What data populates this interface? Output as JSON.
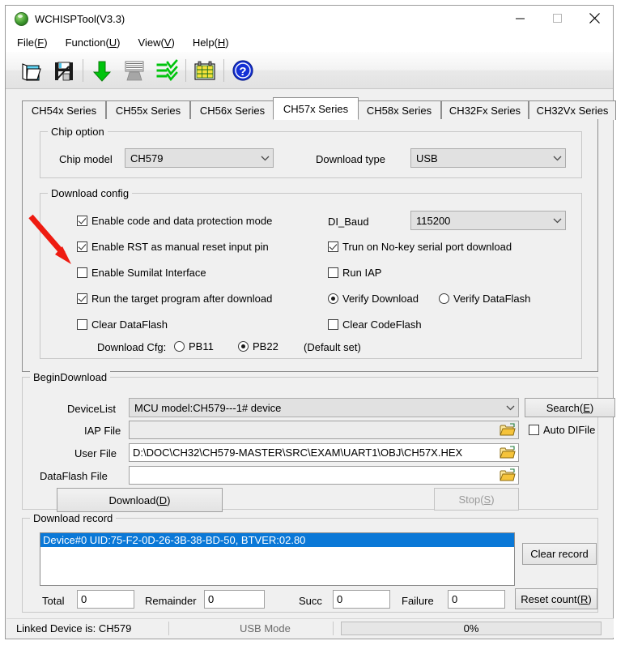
{
  "window": {
    "title": "WCHISPTool(V3.3)",
    "icon": "app-globe-icon",
    "minimize": "minimize-icon",
    "maximize": "maximize-icon",
    "close": "close-icon"
  },
  "menu": [
    {
      "label": "File(F)",
      "text": "File(",
      "accel": "F",
      "tail": ")"
    },
    {
      "label": "Function(U)",
      "text": "Function(",
      "accel": "U",
      "tail": ")"
    },
    {
      "label": "View(V)",
      "text": "View(",
      "accel": "V",
      "tail": ")"
    },
    {
      "label": "Help(H)",
      "text": "Help(",
      "accel": "H",
      "tail": ")"
    }
  ],
  "toolbar": {
    "items": [
      {
        "name": "open-file-icon"
      },
      {
        "name": "save-file-icon"
      },
      {
        "name": "download-arrow-icon"
      },
      {
        "name": "erase-chip-icon"
      },
      {
        "name": "verify-list-icon"
      },
      {
        "name": "config-table-icon"
      },
      {
        "name": "help-question-icon"
      }
    ]
  },
  "tabs": [
    {
      "label": "CH54x Series",
      "active": false
    },
    {
      "label": "CH55x Series",
      "active": false
    },
    {
      "label": "CH56x Series",
      "active": false
    },
    {
      "label": "CH57x Series",
      "active": true
    },
    {
      "label": "CH58x Series",
      "active": false
    },
    {
      "label": "CH32Fx Series",
      "active": false
    },
    {
      "label": "CH32Vx Series",
      "active": false
    }
  ],
  "chip_option": {
    "group_label": "Chip option",
    "chip_model_label": "Chip model",
    "chip_model_value": "CH579",
    "download_type_label": "Download type",
    "download_type_value": "USB"
  },
  "download_config": {
    "group_label": "Download config",
    "checkboxes_left": [
      {
        "label": "Enable code and data protection mode",
        "checked": true
      },
      {
        "label": "Enable RST as manual reset input pin",
        "checked": true
      },
      {
        "label": "Enable Sumilat Interface",
        "checked": false
      },
      {
        "label": "Run the target program after download",
        "checked": true
      },
      {
        "label": "Clear DataFlash",
        "checked": false
      }
    ],
    "di_baud_label": "DI_Baud",
    "di_baud_value": "115200",
    "checkbox_nokey": {
      "label": "Trun on No-key serial port download",
      "checked": true
    },
    "checkbox_runiap": {
      "label": "Run IAP",
      "checked": false
    },
    "radio_verify_download": {
      "label": "Verify Download",
      "selected": true
    },
    "radio_verify_dataflash": {
      "label": "Verify DataFlash",
      "selected": false
    },
    "checkbox_clear_codeflash": {
      "label": "Clear CodeFlash",
      "checked": false
    },
    "download_cfg_label": "Download Cfg:",
    "radio_pb11": {
      "label": "PB11",
      "selected": false
    },
    "radio_pb22": {
      "label": "PB22",
      "selected": true
    },
    "default_set_note": "(Default set)"
  },
  "begin_download": {
    "group_label": "BeginDownload",
    "device_list_label": "DeviceList",
    "device_list_value": "MCU model:CH579---1# device",
    "search_button": {
      "text": "Search(",
      "accel": "E",
      "tail": ")"
    },
    "iap_file_label": "IAP File",
    "iap_file_value": "",
    "auto_difile": {
      "label": "Auto DIFile",
      "checked": false
    },
    "user_file_label": "User File",
    "user_file_value": "D:\\DOC\\CH32\\CH579-MASTER\\SRC\\EXAM\\UART1\\OBJ\\CH57X.HEX",
    "dataflash_file_label": "DataFlash File",
    "dataflash_file_value": "",
    "download_button": {
      "text": "Download(",
      "accel": "D",
      "tail": ")"
    },
    "stop_button": {
      "text": "Stop(",
      "accel": "S",
      "tail": ")",
      "disabled": true
    }
  },
  "download_record": {
    "group_label": "Download record",
    "rows": [
      {
        "text": "Device#0  UID:75-F2-0D-26-3B-38-BD-50, BTVER:02.80",
        "selected": true
      }
    ],
    "clear_record_button": "Clear record",
    "counters": [
      {
        "label": "Total",
        "value": "0"
      },
      {
        "label": "Remainder",
        "value": "0"
      },
      {
        "label": "Succ",
        "value": "0"
      },
      {
        "label": "Failure",
        "value": "0"
      }
    ],
    "reset_count_button": {
      "text": "Reset count(",
      "accel": "R",
      "tail": ")"
    }
  },
  "statusbar": {
    "linked_device": "Linked Device is: CH579",
    "mode": "USB Mode",
    "progress_text": "0%",
    "progress_percent": 0
  },
  "annotation": {
    "arrow_color": "#ee1b11",
    "points_to": "Enable Sumilat Interface"
  },
  "colors": {
    "selection_blue": "#0a78d7",
    "window_bg": "#f0f0f0",
    "field_bg": "#ffffff",
    "combo_bg": "#e1e1e1",
    "arrow_red": "#ee1b11"
  }
}
